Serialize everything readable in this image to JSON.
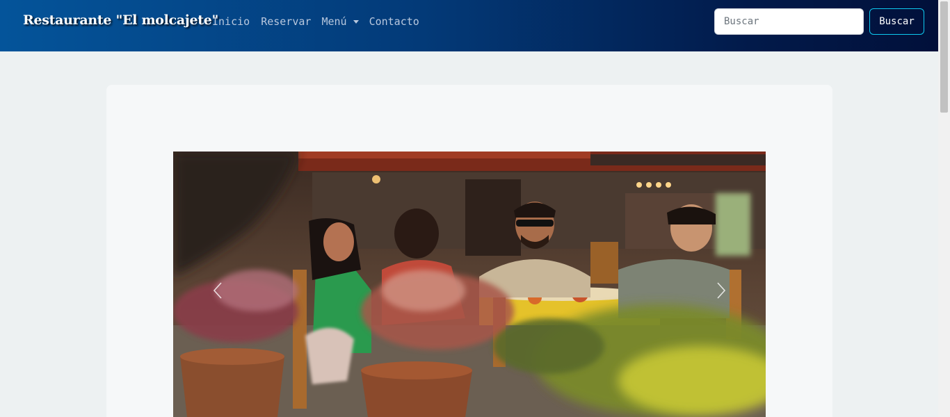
{
  "navbar": {
    "brand": "Restaurante \"El molcajete\"",
    "links": {
      "inicio": "Inicio",
      "reservar": "Reservar",
      "menu": "Menú",
      "contacto": "Contacto"
    },
    "search": {
      "placeholder": "Buscar",
      "value": "",
      "button_label": "Buscar"
    }
  },
  "carousel": {
    "icons": {
      "prev": "chevron-left-icon",
      "next": "chevron-right-icon"
    }
  },
  "colors": {
    "navbar_start": "#04549a",
    "navbar_end": "#01103a",
    "search_button_border": "#0dcaf0",
    "page_background": "#edf1f2",
    "card_background": "#f6f8f9"
  }
}
